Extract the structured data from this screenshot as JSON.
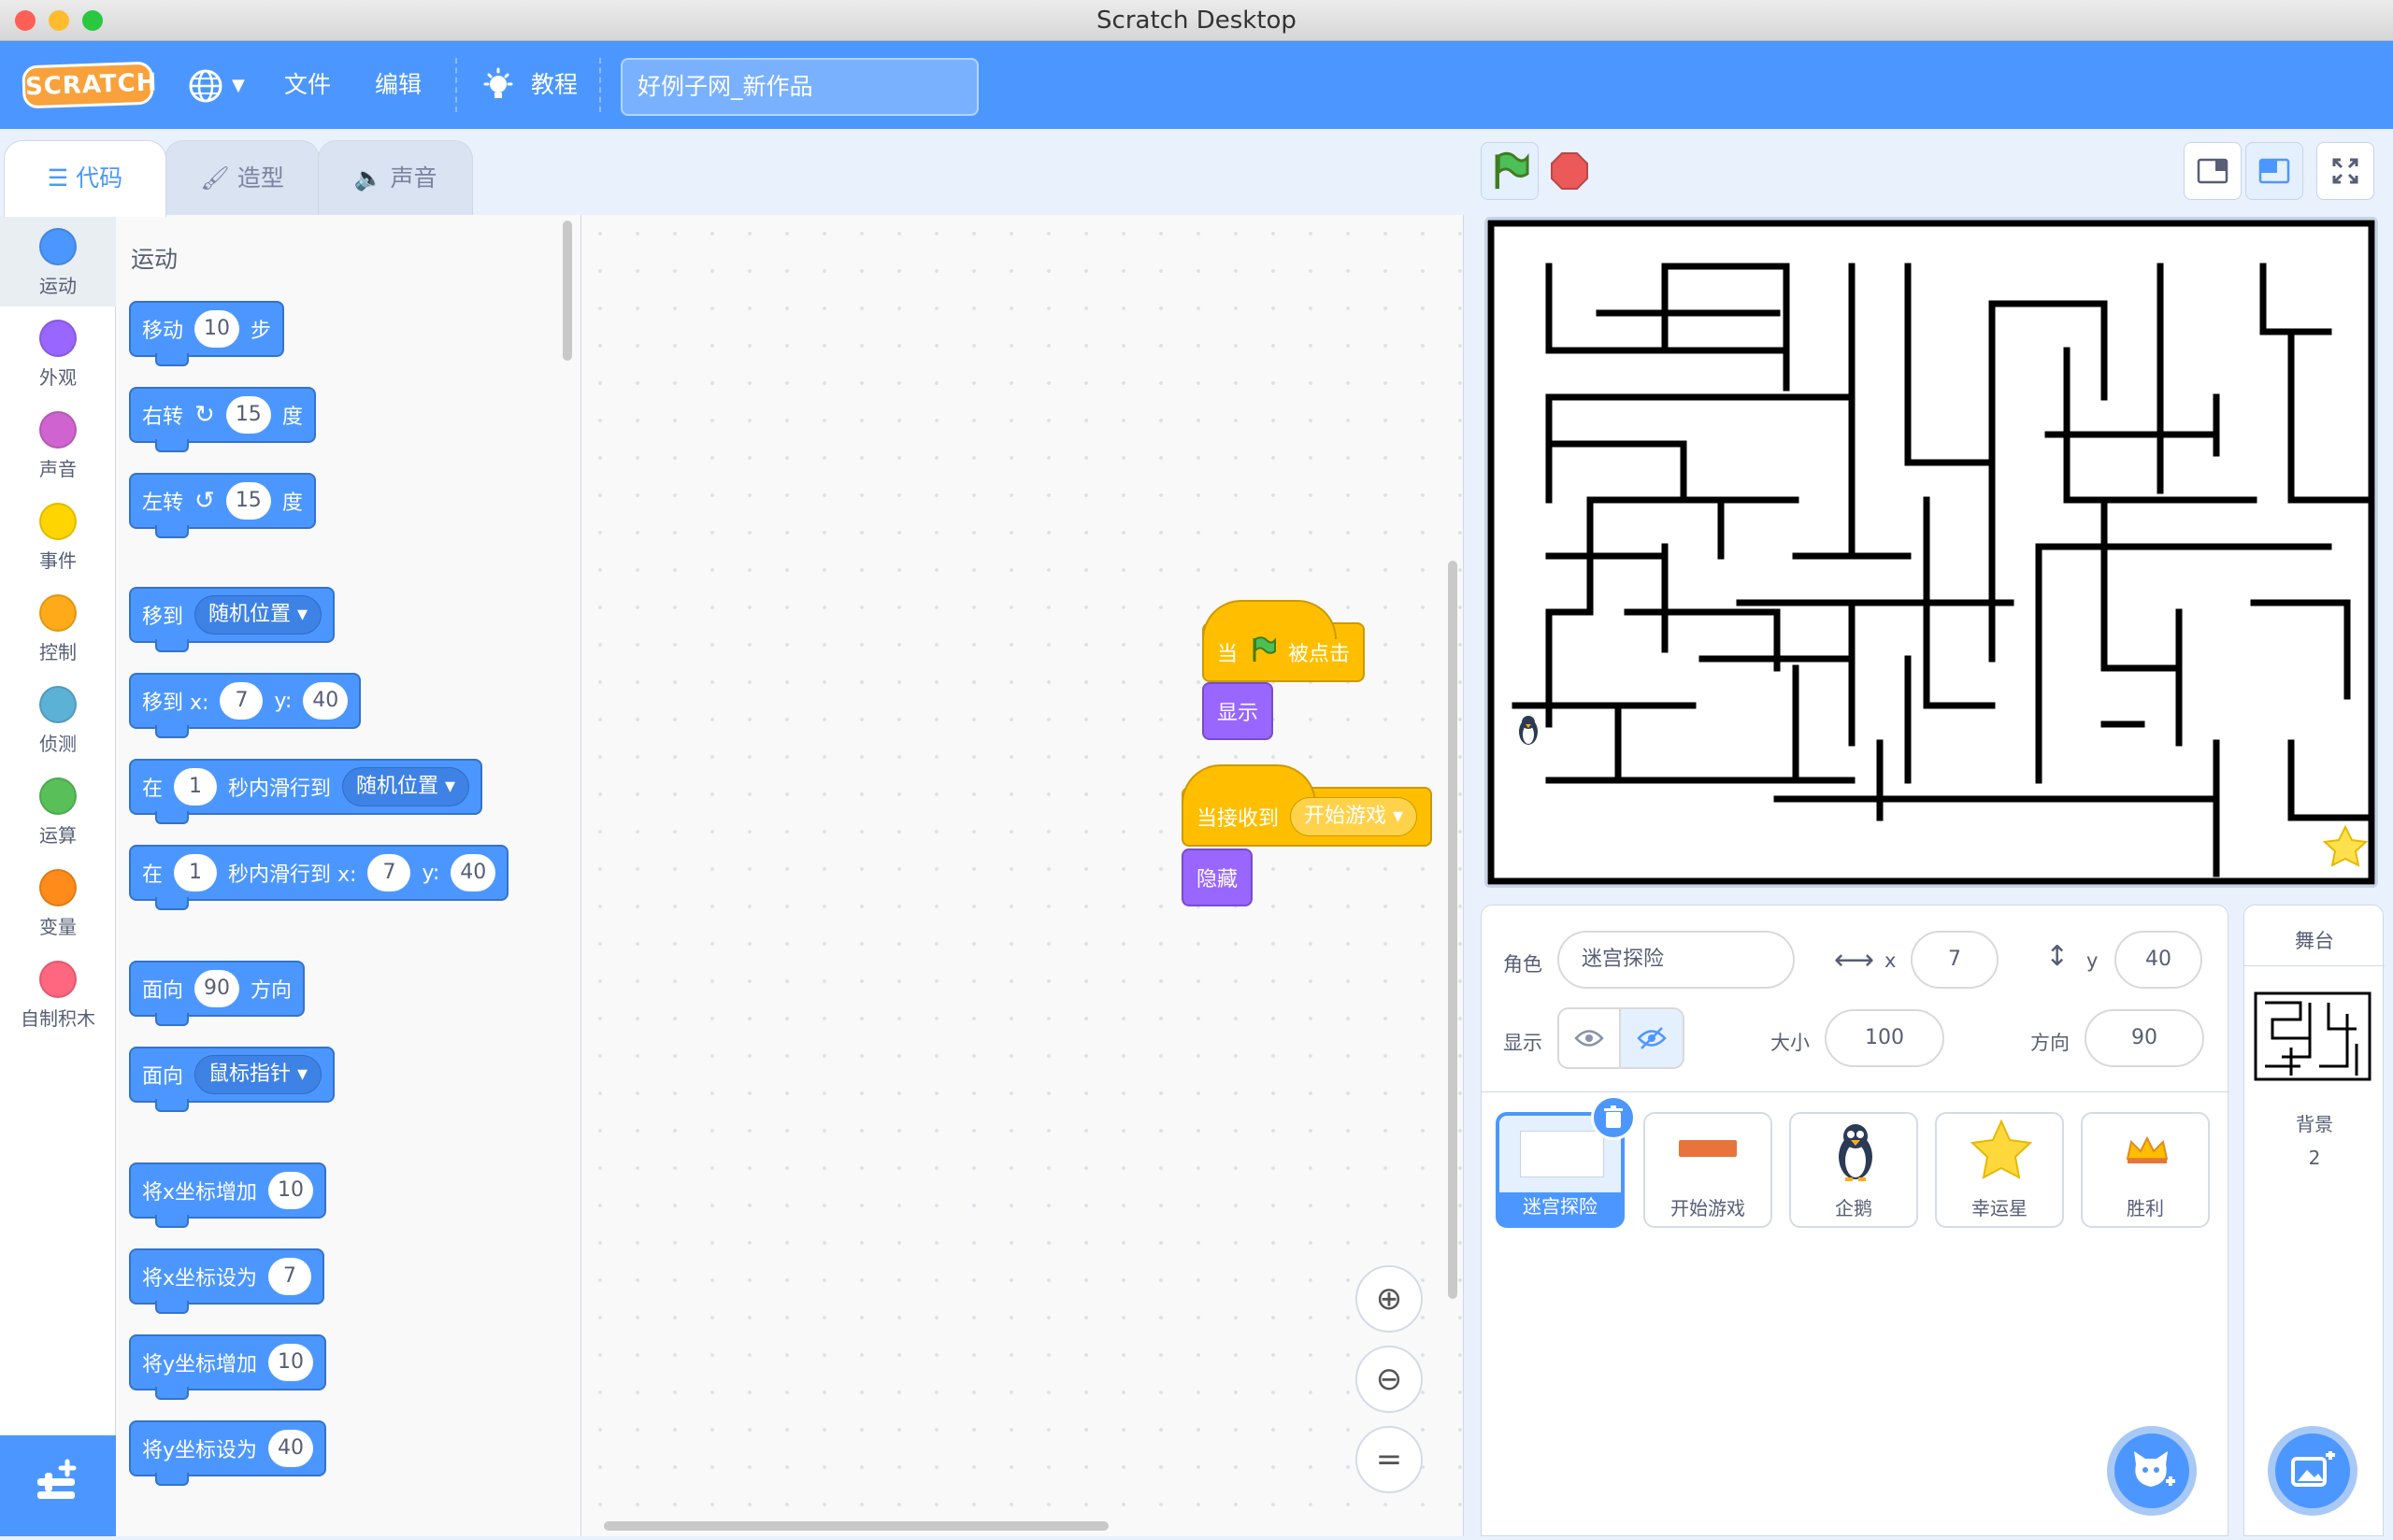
{
  "window": {
    "title": "Scratch Desktop"
  },
  "menubar": {
    "logo": "SCRATCH",
    "file": "文件",
    "edit": "编辑",
    "tutorials": "教程",
    "project_title": "好例子网_新作品"
  },
  "tabs": {
    "code": "代码",
    "costumes": "造型",
    "sounds": "声音"
  },
  "categories": [
    {
      "label": "运动",
      "color": "#4c97ff"
    },
    {
      "label": "外观",
      "color": "#9966ff"
    },
    {
      "label": "声音",
      "color": "#cf63cf"
    },
    {
      "label": "事件",
      "color": "#ffd500"
    },
    {
      "label": "控制",
      "color": "#ffab19"
    },
    {
      "label": "侦测",
      "color": "#5cb1d6"
    },
    {
      "label": "运算",
      "color": "#59c059"
    },
    {
      "label": "变量",
      "color": "#ff8c1a"
    },
    {
      "label": "自制积木",
      "color": "#ff6680"
    }
  ],
  "palette": {
    "section": "运动",
    "move": {
      "a": "移动",
      "v": "10",
      "b": "步"
    },
    "turn_right": {
      "a": "右转",
      "v": "15",
      "b": "度"
    },
    "turn_left": {
      "a": "左转",
      "v": "15",
      "b": "度"
    },
    "goto": {
      "a": "移到",
      "dd": "随机位置"
    },
    "goto_xy": {
      "a": "移到 x:",
      "x": "7",
      "b": "y:",
      "y": "40"
    },
    "glide": {
      "a": "在",
      "v": "1",
      "b": "秒内滑行到",
      "dd": "随机位置"
    },
    "glide_xy": {
      "a": "在",
      "v": "1",
      "b": "秒内滑行到 x:",
      "x": "7",
      "c": "y:",
      "y": "40"
    },
    "point_dir": {
      "a": "面向",
      "v": "90",
      "b": "方向"
    },
    "point_towards": {
      "a": "面向",
      "dd": "鼠标指针"
    },
    "change_x": {
      "a": "将x坐标增加",
      "v": "10"
    },
    "set_x": {
      "a": "将x坐标设为",
      "v": "7"
    },
    "change_y": {
      "a": "将y坐标增加",
      "v": "10"
    },
    "set_y": {
      "a": "将y坐标设为",
      "v": "40"
    }
  },
  "workspace": {
    "script1": {
      "hat_a": "当",
      "hat_b": "被点击",
      "block": "显示"
    },
    "script2": {
      "hat_a": "当接收到",
      "dd": "开始游戏",
      "block": "隐藏"
    },
    "zoom_reset": "="
  },
  "sprite_info": {
    "sprite_label": "角色",
    "sprite_name": "迷宫探险",
    "x_label": "x",
    "x": "7",
    "y_label": "y",
    "y": "40",
    "show_label": "显示",
    "size_label": "大小",
    "size": "100",
    "direction_label": "方向",
    "direction": "90"
  },
  "sprites": [
    {
      "name": "迷宫探险",
      "selected": true
    },
    {
      "name": "开始游戏",
      "selected": false
    },
    {
      "name": "企鹅",
      "selected": false
    },
    {
      "name": "幸运星",
      "selected": false
    },
    {
      "name": "胜利",
      "selected": false
    }
  ],
  "stage_panel": {
    "title": "舞台",
    "backdrops_label": "背景",
    "backdrops_count": "2"
  }
}
